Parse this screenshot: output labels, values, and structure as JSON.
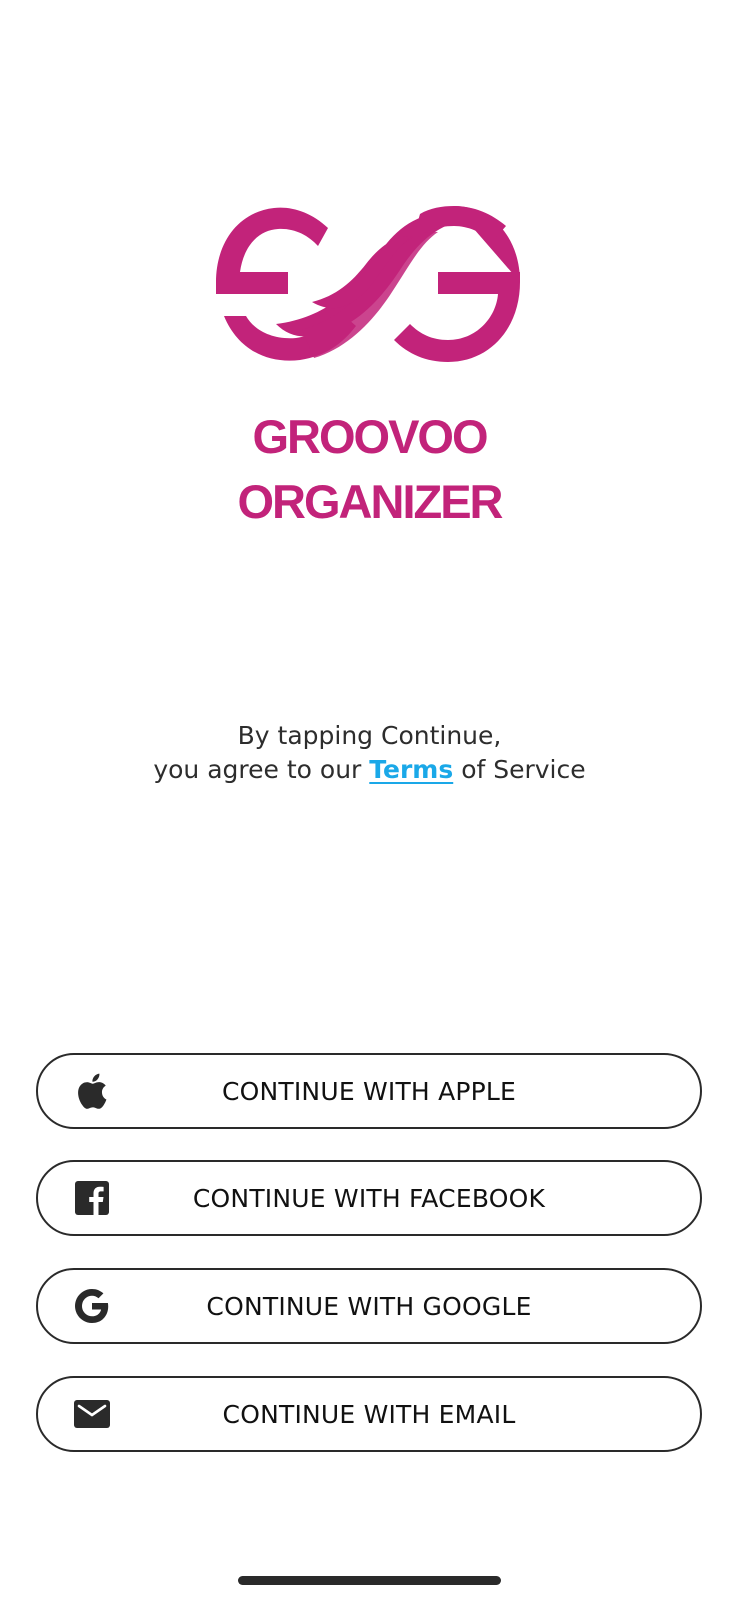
{
  "brand": {
    "line1": "GROOVOO",
    "line2": "ORGANIZER",
    "color": "#c2237a"
  },
  "legal": {
    "line1": "By tapping Continue,",
    "line2_prefix": "you agree to our",
    "terms_link": "Terms",
    "line2_suffix": "of Service",
    "link_color": "#1aa8e8"
  },
  "buttons": [
    {
      "label": "CONTINUE WITH APPLE",
      "icon": "apple-icon"
    },
    {
      "label": "CONTINUE WITH FACEBOOK",
      "icon": "facebook-icon"
    },
    {
      "label": "CONTINUE WITH GOOGLE",
      "icon": "google-icon"
    },
    {
      "label": "CONTINUE WITH EMAIL",
      "icon": "email-icon"
    }
  ]
}
